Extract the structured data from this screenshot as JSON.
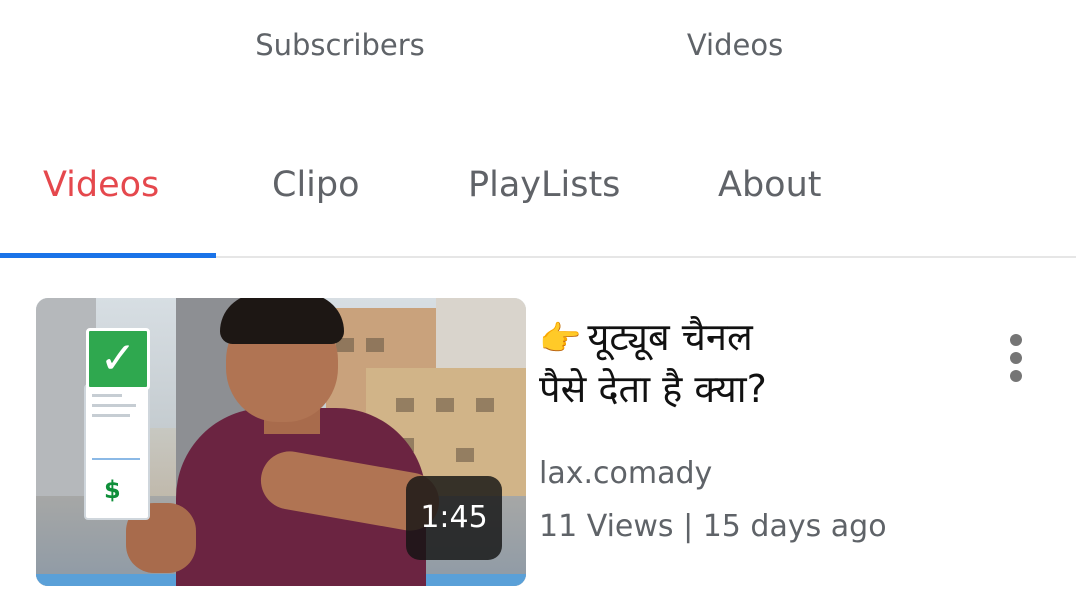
{
  "stats": {
    "subscribers_label": "Subscribers",
    "videos_label": "Videos"
  },
  "tabs": [
    {
      "label": "Videos",
      "active": true
    },
    {
      "label": "Clipo",
      "active": false
    },
    {
      "label": "PlayLists",
      "active": false
    },
    {
      "label": "About",
      "active": false
    }
  ],
  "colors": {
    "active_tab": "#e5484d",
    "tab_indicator": "#1a73e8",
    "inactive_text": "#606368"
  },
  "video": {
    "title_emoji": "👉",
    "title_line1": "यूट्यूब चैनल",
    "title_line2": "पैसे देता है क्या?",
    "channel": "lax.comady",
    "meta": "11 Views | 15 days ago",
    "duration": "1:45",
    "thumbnail_icons": [
      "checkmark-icon",
      "dollar-icon"
    ]
  },
  "icons": {
    "more": "kebab-menu-icon"
  }
}
